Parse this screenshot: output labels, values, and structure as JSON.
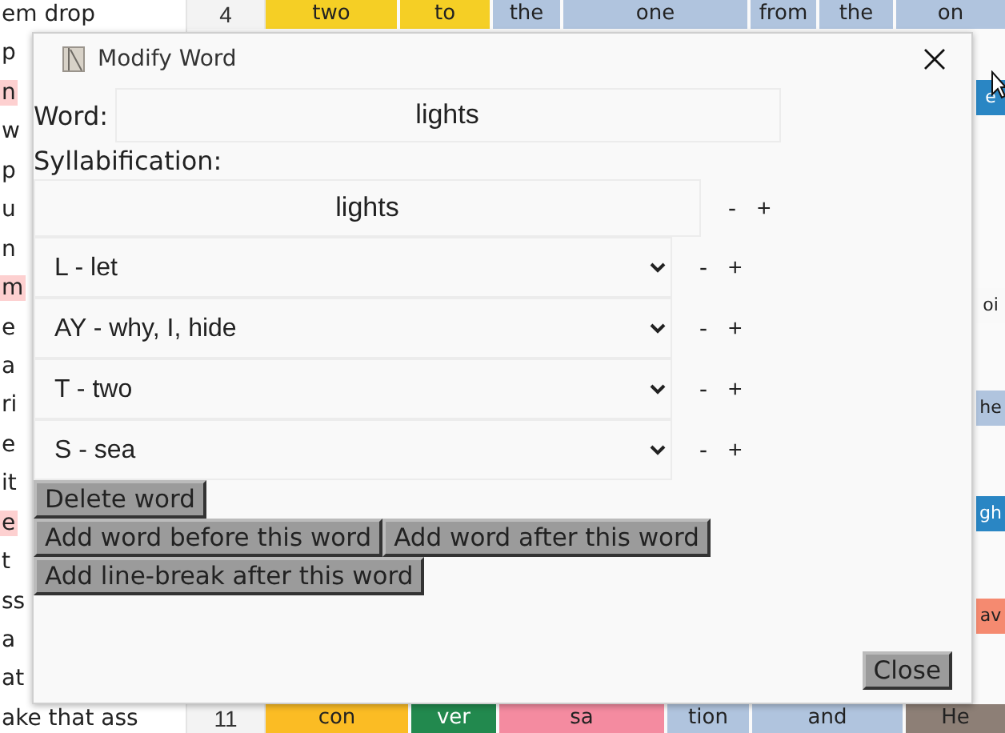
{
  "document_text": {
    "lines": [
      {
        "text": "em drop"
      },
      {
        "text": "p"
      },
      {
        "text": "n",
        "color": "#fdd0d0"
      },
      {
        "text": "w"
      },
      {
        "text": "p"
      },
      {
        "text": "u"
      },
      {
        "text": "n"
      },
      {
        "text": "m",
        "color": "#fdd0d0"
      },
      {
        "text": "e"
      },
      {
        "text": "a"
      },
      {
        "text": "ri"
      },
      {
        "text": "e"
      },
      {
        "text": "it"
      },
      {
        "text": "e",
        "color": "#fdd0d0"
      },
      {
        "text": "t"
      },
      {
        "text": "ss"
      },
      {
        "text": "a"
      },
      {
        "text": "at"
      },
      {
        "text": "ake that ass"
      }
    ]
  },
  "word_grid": {
    "top_row": {
      "number": "4",
      "words": [
        {
          "text": "two",
          "color": "#f5cf25"
        },
        {
          "text": "to",
          "color": "#f5cf25"
        },
        {
          "text": "the",
          "color": "#b0c4de"
        },
        {
          "text": "one",
          "color": "#b0c4de"
        },
        {
          "text": "from",
          "color": "#b0c4de"
        },
        {
          "text": "the",
          "color": "#b0c4de"
        },
        {
          "text": "on",
          "color": "#b0c4de"
        }
      ]
    },
    "edge_words": [
      {
        "text": "e",
        "color": "#2a86c4"
      },
      {
        "text": "oi",
        "color": "#f9f9f9"
      },
      {
        "text": "he",
        "color": "#b0c4de"
      },
      {
        "text": "gh",
        "color": "#2a86c4"
      },
      {
        "text": "av",
        "color": "#f58a70"
      }
    ],
    "bottom_row": {
      "number": "11",
      "words": [
        {
          "text": "con",
          "color": "#fbbc24"
        },
        {
          "text": "ver",
          "color": "#22894e"
        },
        {
          "text": "sa",
          "color": "#f48ba0"
        },
        {
          "text": "tion",
          "color": "#b0c4de"
        },
        {
          "text": "and",
          "color": "#b0c4de"
        },
        {
          "text": "He",
          "color": "#8d7f76"
        }
      ]
    }
  },
  "dialog": {
    "title": "Modify Word",
    "word_label": "Word:",
    "word_value": "lights",
    "syllabification_label": "Syllabification:",
    "syllabification_value": "lights",
    "syllabification_controls": [
      "-",
      "+"
    ],
    "phonemes": [
      {
        "value": "L - let",
        "controls": [
          "-",
          "+"
        ]
      },
      {
        "value": "AY - why, I, hide",
        "controls": [
          "-",
          "+"
        ]
      },
      {
        "value": "T - two",
        "controls": [
          "-",
          "+"
        ]
      },
      {
        "value": "S - sea",
        "controls": [
          "-",
          "+"
        ]
      }
    ],
    "action_rows": [
      [
        "Delete word"
      ],
      [
        "Add word before this word",
        "Add word after this word"
      ],
      [
        "Add line-break after this word"
      ]
    ],
    "close_button": "Close"
  }
}
